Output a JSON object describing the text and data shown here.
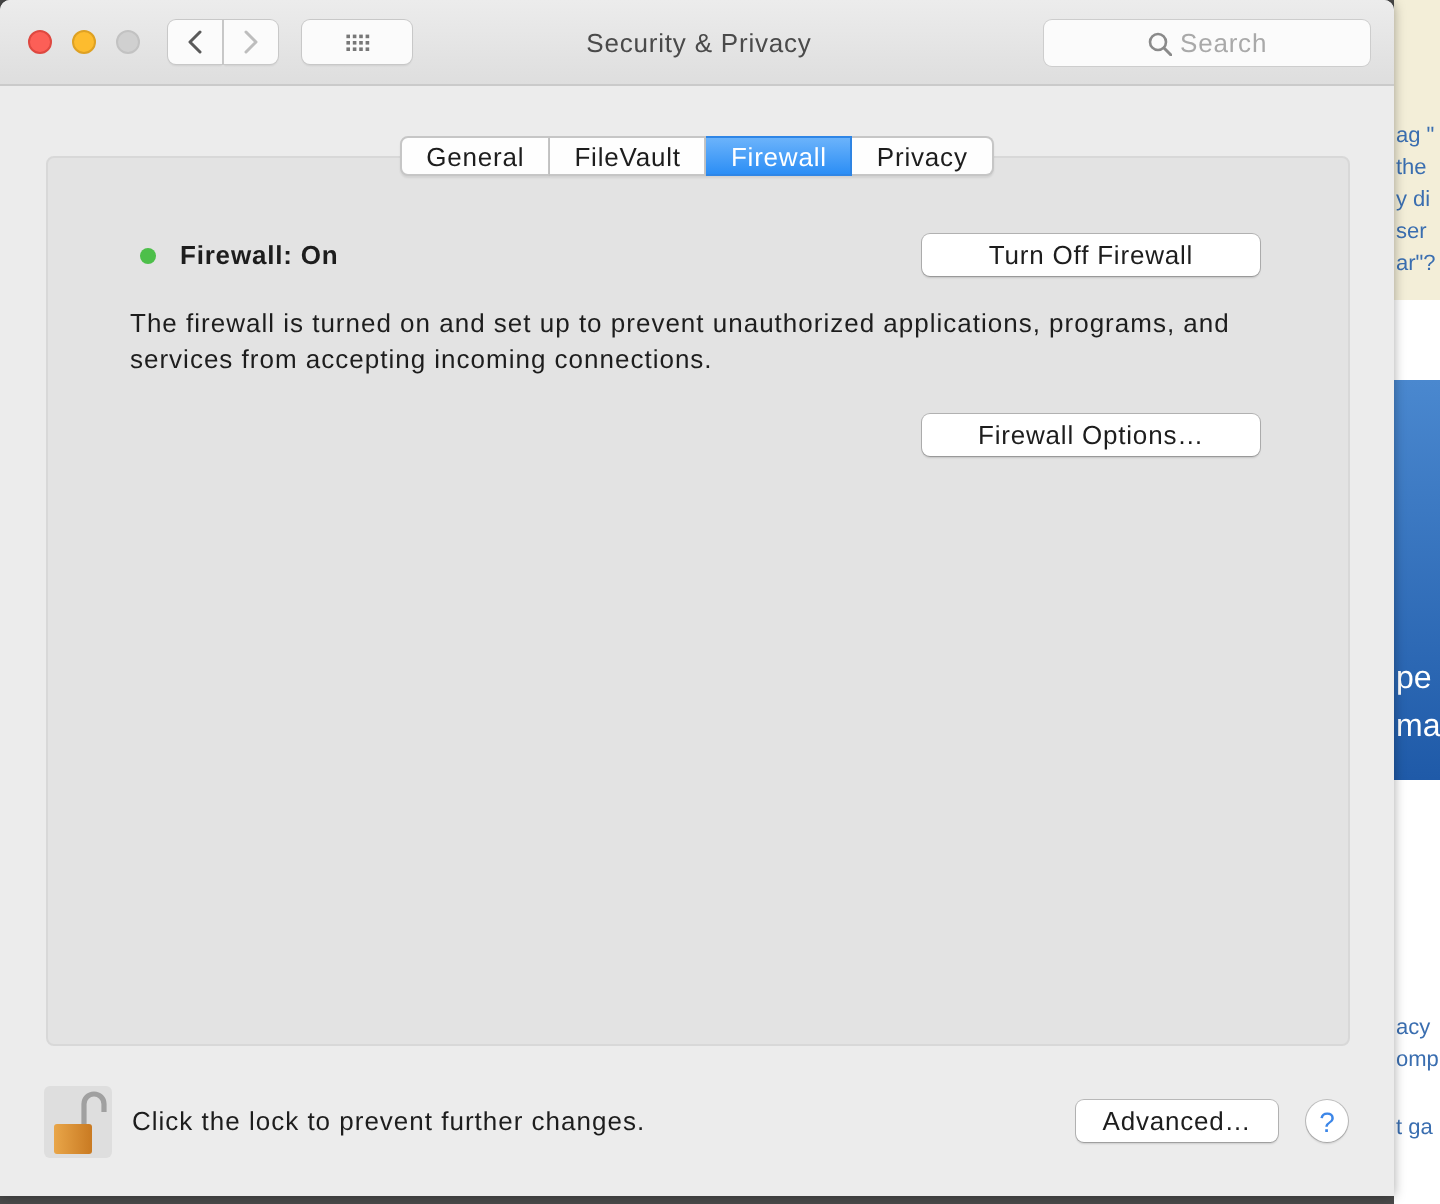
{
  "window": {
    "title": "Security & Privacy",
    "buttons": [
      {
        "kind": "close",
        "disabled": false
      },
      {
        "kind": "minimize",
        "disabled": false
      },
      {
        "kind": "zoom",
        "disabled": true
      }
    ]
  },
  "toolbar": {
    "nav": [
      {
        "kind": "back",
        "disabled": false
      },
      {
        "kind": "forward",
        "disabled": true
      }
    ],
    "search": {
      "placeholder": "Search"
    }
  },
  "tabs": [
    {
      "label": "General",
      "selected": false
    },
    {
      "label": "FileVault",
      "selected": false
    },
    {
      "label": "Firewall",
      "selected": true
    },
    {
      "label": "Privacy",
      "selected": false
    }
  ],
  "firewall": {
    "status": "Firewall: On",
    "on": true,
    "toggle_button": "Turn Off Firewall",
    "description": "The firewall is turned on and set up to prevent unauthorized applications, programs, and services from accepting incoming connections.",
    "options_button": "Firewall Options…"
  },
  "footer": {
    "locked": false,
    "lock_text": "Click the lock to prevent further changes.",
    "advanced_button": "Advanced…",
    "help_button": "?"
  },
  "background_page": {
    "sections": [
      {
        "kind": "notice",
        "lines": [
          "ag \"",
          "the",
          "y di",
          "ser",
          "ar\"?"
        ]
      },
      {
        "kind": "banner",
        "lines": [
          "pe",
          "ma"
        ]
      },
      {
        "kind": "links",
        "lines": [
          "acy",
          "omp"
        ]
      },
      {
        "kind": "links",
        "lines": [
          "t ga"
        ]
      }
    ]
  }
}
